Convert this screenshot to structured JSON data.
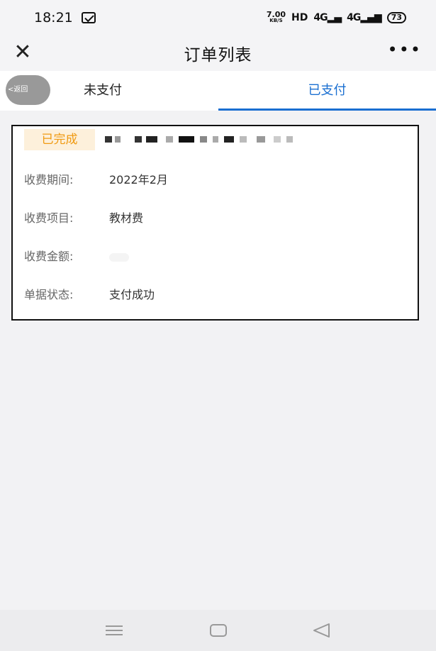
{
  "status_bar": {
    "time": "18:21",
    "net_speed_value": "7.00",
    "net_speed_unit": "KB/S",
    "hd_label": "HD",
    "signal_1": "4G",
    "signal_2": "4G",
    "battery": "73"
  },
  "nav": {
    "title": "订单列表",
    "close_icon": "close-icon",
    "more_icon": "more-icon"
  },
  "tabs": {
    "back_label": "返回",
    "unpaid": "未支付",
    "paid": "已支付",
    "active": "paid"
  },
  "order": {
    "status": "已完成",
    "rows": [
      {
        "label": "收费期间:",
        "value": "2022年2月"
      },
      {
        "label": "收费项目:",
        "value": "教材费"
      },
      {
        "label": "收费金额:",
        "value": ""
      },
      {
        "label": "单据状态:",
        "value": "支付成功"
      }
    ]
  },
  "colors": {
    "accent": "#1a6fd1",
    "tag_text": "#f09a12",
    "tag_bg": "#fdf0db"
  }
}
